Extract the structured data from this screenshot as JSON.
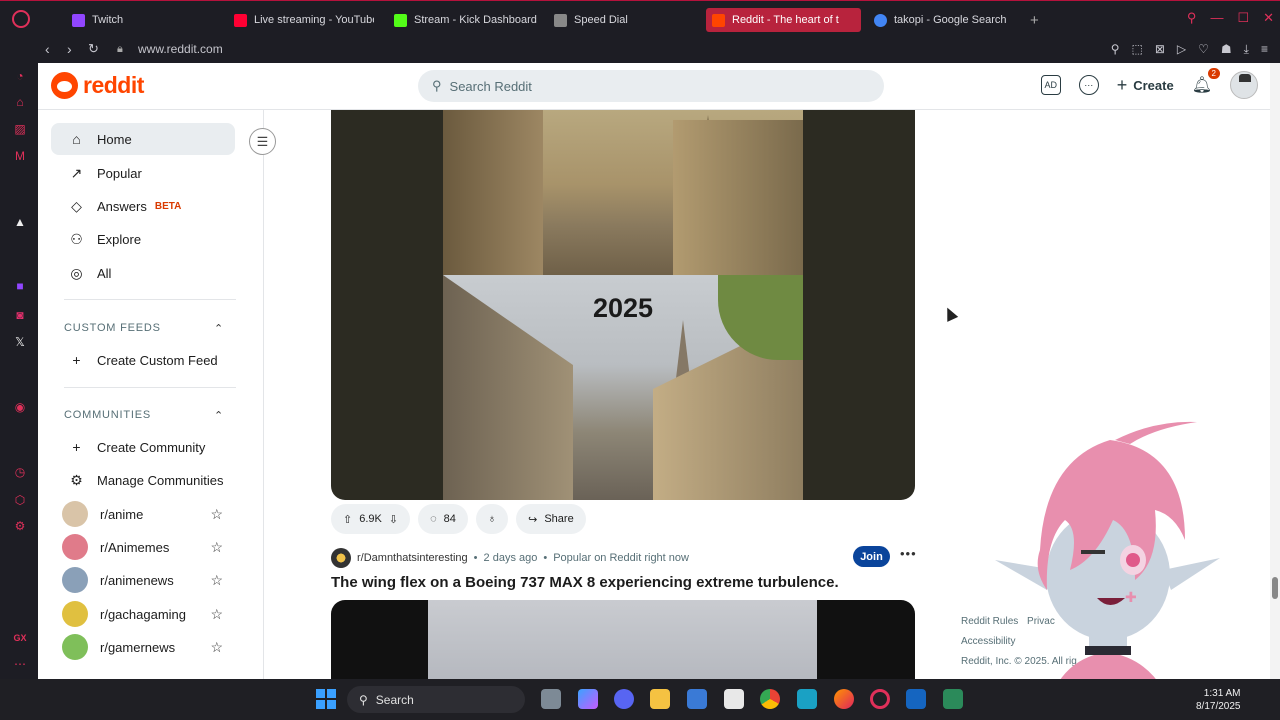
{
  "browser": {
    "tabs": [
      {
        "label": "Twitch",
        "color": "#9146ff"
      },
      {
        "label": "Live streaming - YouTube",
        "color": "#ff0033"
      },
      {
        "label": "Stream - Kick Dashboard",
        "color": "#53fc18"
      },
      {
        "label": "Speed Dial",
        "color": "#888888"
      },
      {
        "label": "Reddit - The heart of t",
        "color": "#ff4500",
        "active": true
      },
      {
        "label": "takopi - Google Search",
        "color": "#4285f4"
      }
    ],
    "url": "www.reddit.com"
  },
  "reddit": {
    "logo_text": "reddit",
    "search_placeholder": "Search Reddit",
    "create_label": "Create",
    "notification_count": "2",
    "nav": [
      {
        "label": "Home",
        "icon": "home-icon",
        "active": true
      },
      {
        "label": "Popular",
        "icon": "popular-icon"
      },
      {
        "label": "Answers",
        "icon": "answers-icon",
        "badge": "BETA"
      },
      {
        "label": "Explore",
        "icon": "explore-icon"
      },
      {
        "label": "All",
        "icon": "all-icon"
      }
    ],
    "custom_feeds": {
      "title": "CUSTOM FEEDS",
      "create_label": "Create Custom Feed"
    },
    "communities": {
      "title": "COMMUNITIES",
      "create_label": "Create Community",
      "manage_label": "Manage Communities",
      "items": [
        {
          "name": "r/anime",
          "color": "#d9c4a8"
        },
        {
          "name": "r/Animemes",
          "color": "#e07b8a"
        },
        {
          "name": "r/animenews",
          "color": "#8aa0b8"
        },
        {
          "name": "r/gachagaming",
          "color": "#e0c040"
        },
        {
          "name": "r/gamernews",
          "color": "#7fbf5a"
        }
      ]
    },
    "post1": {
      "image_caption": "2025",
      "upvotes": "6.9K",
      "comments": "84",
      "share_label": "Share"
    },
    "post2": {
      "subreddit": "r/Damnthatsinteresting",
      "age": "2 days ago",
      "context": "Popular on Reddit right now",
      "join_label": "Join",
      "title": "The wing flex on a Boeing 737 MAX 8 experiencing extreme turbulence."
    },
    "footer": {
      "rules": "Reddit Rules",
      "privacy": "Privac",
      "accessibility": "Accessibility",
      "copyright": "Reddit, Inc. © 2025. All rig"
    }
  },
  "taskbar": {
    "search_label": "Search",
    "time": "1:31 AM",
    "date": "8/17/2025"
  }
}
